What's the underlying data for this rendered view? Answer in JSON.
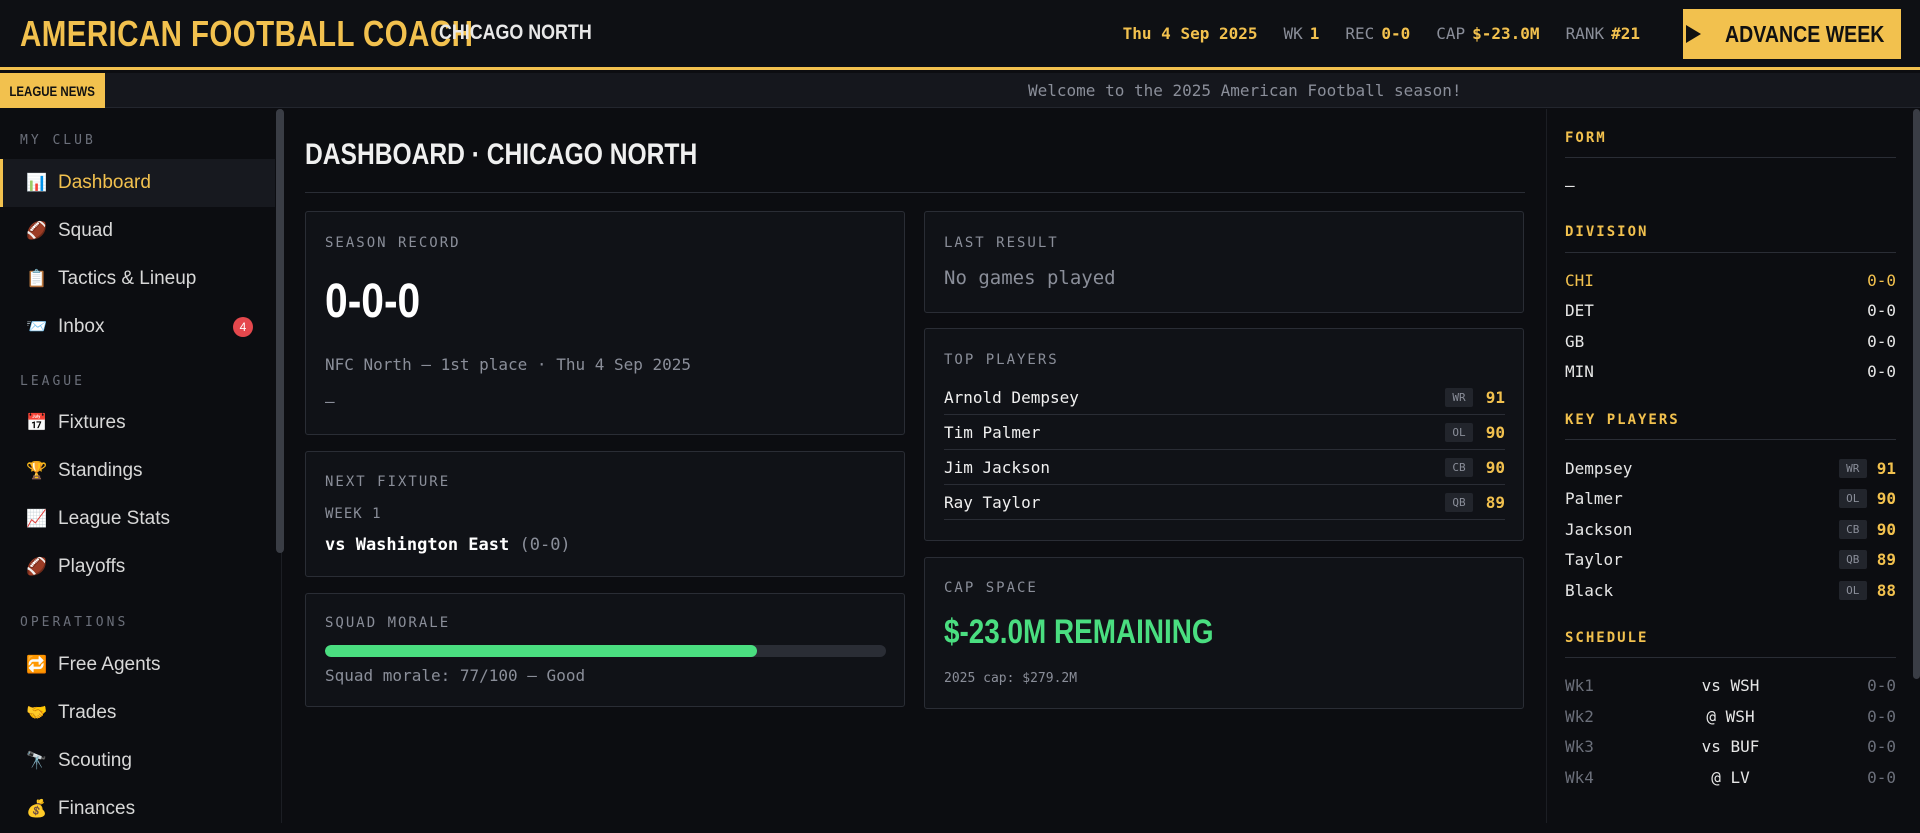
{
  "header": {
    "brand": "AMERICAN FOOTBALL COACH",
    "club": "CHICAGO NORTH",
    "date": "Thu 4 Sep 2025",
    "stats": [
      {
        "label": "WK",
        "value": "1"
      },
      {
        "label": "REC",
        "value": "0-0"
      },
      {
        "label": "CAP",
        "value": "$-23.0M"
      },
      {
        "label": "RANK",
        "value": "#21"
      }
    ],
    "advance_label": "ADVANCE WEEK"
  },
  "ticker": {
    "tag": "LEAGUE NEWS",
    "text": "Welcome to the 2025 American Football season!"
  },
  "sidebar": {
    "sections": [
      {
        "title": "MY CLUB",
        "items": [
          {
            "label": "Dashboard",
            "icon": "📊",
            "icon_name": "bar-chart-icon",
            "active": true
          },
          {
            "label": "Squad",
            "icon": "🏈",
            "icon_name": "football-icon"
          },
          {
            "label": "Tactics & Lineup",
            "icon": "📋",
            "icon_name": "clipboard-icon"
          },
          {
            "label": "Inbox",
            "icon": "📨",
            "icon_name": "inbox-icon",
            "badge": "4"
          }
        ]
      },
      {
        "title": "LEAGUE",
        "items": [
          {
            "label": "Fixtures",
            "icon": "📅",
            "icon_name": "calendar-icon"
          },
          {
            "label": "Standings",
            "icon": "🏆",
            "icon_name": "trophy-icon"
          },
          {
            "label": "League Stats",
            "icon": "📈",
            "icon_name": "chart-up-icon"
          },
          {
            "label": "Playoffs",
            "icon": "🏈",
            "icon_name": "football-icon"
          }
        ]
      },
      {
        "title": "OPERATIONS",
        "items": [
          {
            "label": "Free Agents",
            "icon": "🔁",
            "icon_name": "repeat-icon"
          },
          {
            "label": "Trades",
            "icon": "🤝",
            "icon_name": "handshake-icon"
          },
          {
            "label": "Scouting",
            "icon": "🔭",
            "icon_name": "telescope-icon"
          },
          {
            "label": "Finances",
            "icon": "💰",
            "icon_name": "money-bag-icon"
          }
        ]
      }
    ]
  },
  "main": {
    "title": "DASHBOARD · CHICAGO NORTH",
    "season_record": {
      "label": "SEASON RECORD",
      "record": "0-0-0",
      "sub": "NFC North — 1st place · Thu 4 Sep 2025",
      "dash": "—"
    },
    "next_fixture": {
      "label": "NEXT FIXTURE",
      "week": "WEEK 1",
      "opponent": "vs Washington East",
      "opp_record": "(0-0)"
    },
    "squad_morale": {
      "label": "SQUAD MORALE",
      "value": 77,
      "max": 100,
      "text": "Squad morale: 77/100 — Good",
      "color": "#4ade80"
    },
    "last_result": {
      "label": "LAST RESULT",
      "text": "No games played"
    },
    "top_players": {
      "label": "TOP PLAYERS",
      "players": [
        {
          "name": "Arnold Dempsey",
          "pos": "WR",
          "rating": "91"
        },
        {
          "name": "Tim Palmer",
          "pos": "OL",
          "rating": "90"
        },
        {
          "name": "Jim Jackson",
          "pos": "CB",
          "rating": "90"
        },
        {
          "name": "Ray Taylor",
          "pos": "QB",
          "rating": "89"
        }
      ]
    },
    "cap_space": {
      "label": "CAP SPACE",
      "remaining": "$-23.0M REMAINING",
      "sub": "2025 cap: $279.2M"
    }
  },
  "right_panel": {
    "form": {
      "title": "FORM",
      "value": "—"
    },
    "division": {
      "title": "DIVISION",
      "rows": [
        {
          "team": "CHI",
          "record": "0-0",
          "highlight": true
        },
        {
          "team": "DET",
          "record": "0-0"
        },
        {
          "team": "GB",
          "record": "0-0"
        },
        {
          "team": "MIN",
          "record": "0-0"
        }
      ]
    },
    "key_players": {
      "title": "KEY PLAYERS",
      "rows": [
        {
          "name": "Dempsey",
          "pos": "WR",
          "rating": "91"
        },
        {
          "name": "Palmer",
          "pos": "OL",
          "rating": "90"
        },
        {
          "name": "Jackson",
          "pos": "CB",
          "rating": "90"
        },
        {
          "name": "Taylor",
          "pos": "QB",
          "rating": "89"
        },
        {
          "name": "Black",
          "pos": "OL",
          "rating": "88"
        }
      ]
    },
    "schedule": {
      "title": "SCHEDULE",
      "rows": [
        {
          "week": "Wk1",
          "opponent": "vs WSH",
          "result": "0-0"
        },
        {
          "week": "Wk2",
          "opponent": "@ WSH",
          "result": "0-0"
        },
        {
          "week": "Wk3",
          "opponent": "vs BUF",
          "result": "0-0"
        },
        {
          "week": "Wk4",
          "opponent": "@ LV",
          "result": "0-0"
        }
      ]
    }
  },
  "colors": {
    "accent": "#f2c14e",
    "positive": "#4ade80",
    "badge": "#e5484d",
    "background": "#0c0d11"
  }
}
